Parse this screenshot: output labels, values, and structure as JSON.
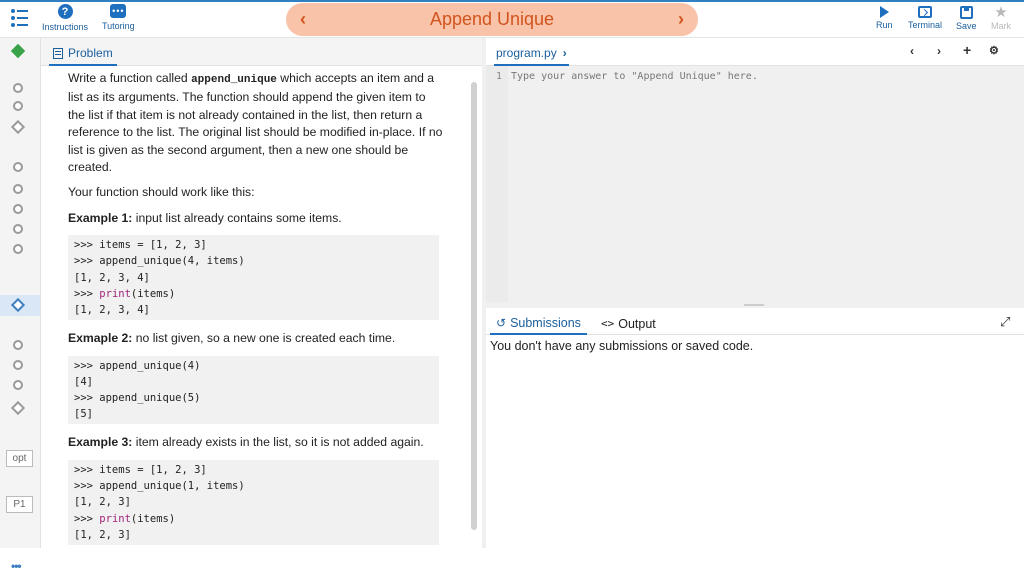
{
  "header": {
    "instructions_label": "Instructions",
    "tutoring_label": "Tutoring",
    "title": "Append Unique",
    "prev_arrow": "‹",
    "next_arrow": "›",
    "run_label": "Run",
    "terminal_label": "Terminal",
    "save_label": "Save",
    "mark_label": "Mark"
  },
  "rail": {
    "opt_label": "opt",
    "p1_label": "P1",
    "more": "•••"
  },
  "problem": {
    "tab_label": "Problem",
    "intro_pre": "Write a function called ",
    "fn_name": "append_unique",
    "intro_post": " which accepts an item and a list as its arguments. The function should append the given item to the list if that item is not already contained in the list, then return a reference to the list. The original list should be modified in-place. If no list is given as the second argument, then a new one should be created.",
    "work_like": "Your function should work like this:",
    "examples": [
      {
        "label": "Example 1:",
        "desc": " input list already contains some items.",
        "lines": [
          ">>> items = [1, 2, 3]",
          ">>> append_unique(4, items)",
          "[1, 2, 3, 4]",
          ">>> print(items)",
          "[1, 2, 3, 4]"
        ]
      },
      {
        "label": "Exmaple 2:",
        "desc": " no list given, so a new one is created each time.",
        "lines": [
          ">>> append_unique(4)",
          "[4]",
          ">>> append_unique(5)",
          "[5]"
        ]
      },
      {
        "label": "Example 3:",
        "desc": " item already exists in the list, so it is not added again.",
        "lines": [
          ">>> items = [1, 2, 3]",
          ">>> append_unique(1, items)",
          "[1, 2, 3]",
          ">>> print(items)",
          "[1, 2, 3]"
        ]
      }
    ]
  },
  "editor": {
    "file_tab": "program.py",
    "file_chevron": "›",
    "nav_prev": "‹",
    "nav_next": "›",
    "add": "+",
    "settings": "⚙",
    "line_number": "1",
    "placeholder_line": "Type your answer to \"Append Unique\" here."
  },
  "lower": {
    "submissions_tab": "Submissions",
    "output_tab": "Output",
    "message": "You don't have any submissions or saved code."
  },
  "colors": {
    "accent": "#1f6fbf",
    "title_pill": "#f8c3a8",
    "title_text": "#d2541e",
    "success": "#3aa34a"
  }
}
